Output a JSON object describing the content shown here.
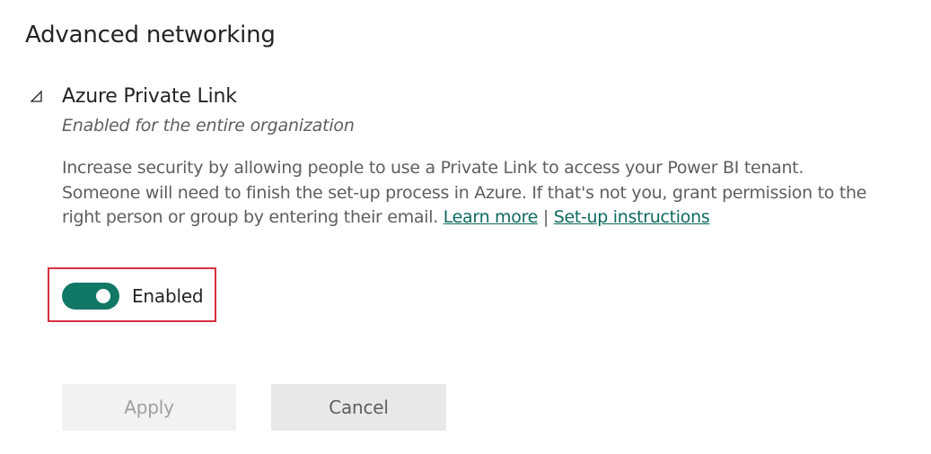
{
  "page": {
    "title": "Advanced networking"
  },
  "setting": {
    "title": "Azure Private Link",
    "subtitle": "Enabled for the entire organization",
    "description": "Increase security by allowing people to use a Private Link to access your Power BI tenant. Someone will need to finish the set-up process in Azure. If that's not you, grant permission to the right person or group by entering their email.",
    "learn_more_link": "Learn more",
    "separator": "|",
    "setup_link": "Set-up instructions",
    "toggle": {
      "label": "Enabled",
      "state": "on"
    }
  },
  "actions": {
    "apply_label": "Apply",
    "cancel_label": "Cancel"
  },
  "colors": {
    "accent": "#117865",
    "link": "#0e6a5f",
    "highlight": "#d9303f"
  },
  "icons": {
    "collapse": "triangle-collapse-icon"
  }
}
